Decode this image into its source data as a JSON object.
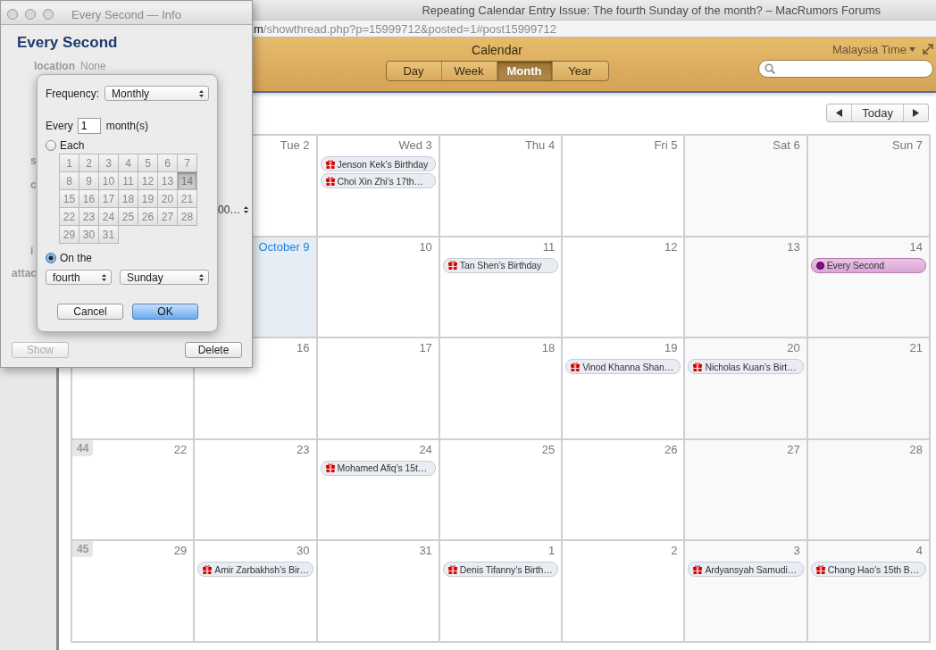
{
  "browser": {
    "title": "Repeating Calendar Entry Issue: The fourth Sunday of the month? – MacRumors Forums",
    "url": {
      "host": "m",
      "path": "/showthread.php?p=15999712&posted=1#post15999712"
    }
  },
  "calendar": {
    "title": "Calendar",
    "views": [
      {
        "label": "Day",
        "selected": false
      },
      {
        "label": "Week",
        "selected": false
      },
      {
        "label": "Month",
        "selected": true
      },
      {
        "label": "Year",
        "selected": false
      }
    ],
    "timezone": "Malaysia Time",
    "today_button": "Today",
    "weeks": [
      {
        "days": [
          {
            "label": "Tue 2",
            "today": false
          },
          {
            "label": "Wed 3",
            "today": false,
            "events": [
              {
                "kind": "birthday",
                "title": "Jenson Kek’s Birthday"
              },
              {
                "kind": "birthday",
                "title": "Choi Xin Zhi’s 17th…"
              }
            ]
          },
          {
            "label": "Thu 4",
            "today": false
          },
          {
            "label": "Fri 5",
            "today": false
          },
          {
            "label": "Sat 6",
            "today": false
          },
          {
            "label": "Sun 7",
            "today": false
          }
        ]
      },
      {
        "days": [
          {
            "label": "October 9",
            "today": true
          },
          {
            "label": "10",
            "today": false
          },
          {
            "label": "11",
            "today": false,
            "events": [
              {
                "kind": "birthday",
                "title": "Tan Shen’s Birthday"
              }
            ]
          },
          {
            "label": "12",
            "today": false
          },
          {
            "label": "13",
            "today": false
          },
          {
            "label": "14",
            "today": false,
            "events": [
              {
                "kind": "event",
                "title": "Every Second",
                "color": "#8b0a8b"
              }
            ]
          }
        ]
      },
      {
        "days": [
          {
            "label": "16",
            "today": false
          },
          {
            "label": "17",
            "today": false
          },
          {
            "label": "18",
            "today": false
          },
          {
            "label": "19",
            "today": false,
            "events": [
              {
                "kind": "birthday",
                "title": "Vinod Khanna Shan…"
              }
            ]
          },
          {
            "label": "20",
            "today": false,
            "events": [
              {
                "kind": "birthday",
                "title": "Nicholas Kuan’s Birt…"
              }
            ]
          },
          {
            "label": "21",
            "today": false
          }
        ]
      },
      {
        "week_number": "44",
        "days": [
          {
            "label": "22",
            "today": false
          },
          {
            "label": "23",
            "today": false
          },
          {
            "label": "24",
            "today": false,
            "events": [
              {
                "kind": "birthday",
                "title": "Mohamed Afiq’s 15t…"
              }
            ]
          },
          {
            "label": "25",
            "today": false
          },
          {
            "label": "26",
            "today": false
          },
          {
            "label": "27",
            "today": false
          },
          {
            "label": "28",
            "today": false
          }
        ]
      },
      {
        "week_number": "45",
        "days": [
          {
            "label": "29",
            "today": false
          },
          {
            "label": "30",
            "today": false,
            "events": [
              {
                "kind": "birthday",
                "title": "Amir Zarbakhsh’s Bir…"
              }
            ]
          },
          {
            "label": "31",
            "today": false
          },
          {
            "label": "1",
            "today": false,
            "events": [
              {
                "kind": "birthday",
                "title": "Denis Tifanny’s Birth…"
              }
            ]
          },
          {
            "label": "2",
            "today": false
          },
          {
            "label": "3",
            "today": false,
            "events": [
              {
                "kind": "birthday",
                "title": "Ardyansyah Samudi…"
              }
            ]
          },
          {
            "label": "4",
            "today": false,
            "events": [
              {
                "kind": "birthday",
                "title": "Chang Hao’s 15th B…"
              }
            ]
          }
        ]
      }
    ]
  },
  "info_window": {
    "title": "Every Second — Info",
    "event_title": "Every Second",
    "fields": [
      {
        "kind": "text",
        "label": "location",
        "value": "None"
      },
      {
        "kind": "text",
        "label": "s"
      },
      {
        "kind": "text",
        "label": "c"
      },
      {
        "kind": "stepper",
        "value": "00…"
      },
      {
        "kind": "text",
        "label": "i"
      },
      {
        "kind": "text",
        "label": "attac"
      }
    ],
    "buttons": [
      {
        "label": "Show",
        "disabled": true
      },
      {
        "label": "Delete",
        "disabled": false
      }
    ]
  },
  "repeat_popover": {
    "frequency_label": "Frequency:",
    "frequency": "Monthly",
    "every_label": "Every",
    "every_value": "1",
    "every_unit": "month(s)",
    "modes": [
      {
        "label": "Each",
        "selected": false
      },
      {
        "label": "On the",
        "selected": true
      }
    ],
    "days": [
      {
        "label": "1",
        "selected": false
      },
      {
        "label": "2",
        "selected": false
      },
      {
        "label": "3",
        "selected": false
      },
      {
        "label": "4",
        "selected": false
      },
      {
        "label": "5",
        "selected": false
      },
      {
        "label": "6",
        "selected": false
      },
      {
        "label": "7",
        "selected": false
      },
      {
        "label": "8",
        "selected": false
      },
      {
        "label": "9",
        "selected": false
      },
      {
        "label": "10",
        "selected": false
      },
      {
        "label": "11",
        "selected": false
      },
      {
        "label": "12",
        "selected": false
      },
      {
        "label": "13",
        "selected": false
      },
      {
        "label": "14",
        "selected": true
      },
      {
        "label": "15",
        "selected": false
      },
      {
        "label": "16",
        "selected": false
      },
      {
        "label": "17",
        "selected": false
      },
      {
        "label": "18",
        "selected": false
      },
      {
        "label": "19",
        "selected": false
      },
      {
        "label": "20",
        "selected": false
      },
      {
        "label": "21",
        "selected": false
      },
      {
        "label": "22",
        "selected": false
      },
      {
        "label": "23",
        "selected": false
      },
      {
        "label": "24",
        "selected": false
      },
      {
        "label": "25",
        "selected": false
      },
      {
        "label": "26",
        "selected": false
      },
      {
        "label": "27",
        "selected": false
      },
      {
        "label": "28",
        "selected": false
      },
      {
        "label": "29",
        "selected": false
      },
      {
        "label": "30",
        "selected": false
      },
      {
        "label": "31",
        "selected": false
      }
    ],
    "ordinal": "fourth",
    "weekday": "Sunday",
    "buttons": [
      {
        "label": "Cancel",
        "default": false
      },
      {
        "label": "OK",
        "default": true
      }
    ]
  }
}
